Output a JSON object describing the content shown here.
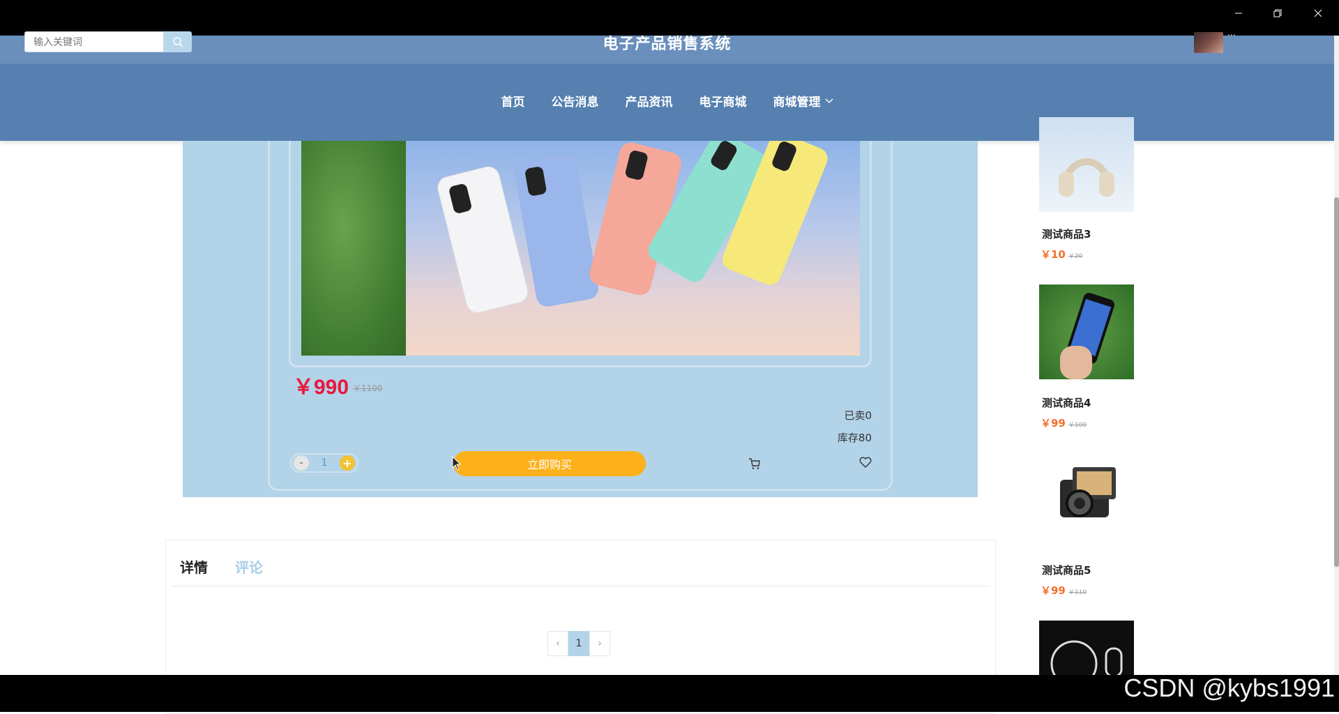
{
  "header": {
    "search_placeholder": "输入关键词",
    "site_title": "电子产品销售系统",
    "user_name": "…"
  },
  "nav": {
    "items": [
      {
        "label": "首页"
      },
      {
        "label": "公告消息"
      },
      {
        "label": "产品资讯"
      },
      {
        "label": "电子商城"
      },
      {
        "label": "商城管理"
      }
    ]
  },
  "product": {
    "price": "￥990",
    "original_price": "￥1100",
    "sold": "已卖0",
    "stock": "库存80",
    "quantity": "1",
    "minus": "-",
    "plus": "+",
    "buy_label": "立即购买"
  },
  "tabs": {
    "detail": "详情",
    "comment": "评论"
  },
  "pagination": {
    "prev": "‹",
    "current": "1",
    "next": "›"
  },
  "sidebar": {
    "items": [
      {
        "name": "测试商品3",
        "price": "￥10",
        "original": "￥20"
      },
      {
        "name": "测试商品4",
        "price": "￥99",
        "original": "￥100"
      },
      {
        "name": "测试商品5",
        "price": "￥99",
        "original": "￥110"
      }
    ]
  },
  "watermark": "CSDN @kybs1991",
  "colors": {
    "nav_bg": "#5580b0",
    "top_strip": "#6a8fbd",
    "product_bg": "#b3d3e8",
    "price": "#e8173f",
    "buy_button": "#fcb01a",
    "side_price": "#f36f2c"
  }
}
